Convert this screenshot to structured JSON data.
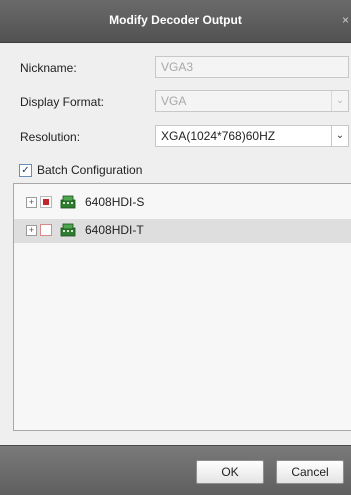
{
  "dialog": {
    "title": "Modify Decoder Output",
    "close_glyph": "×"
  },
  "form": {
    "nickname": {
      "label": "Nickname:",
      "value": "VGA3"
    },
    "display_format": {
      "label": "Display Format:",
      "value": "VGA"
    },
    "resolution": {
      "label": "Resolution:",
      "value": "XGA(1024*768)60HZ"
    },
    "dropdown_glyph": "⌄"
  },
  "batch": {
    "label": "Batch Configuration",
    "checked": true,
    "check_glyph": "✓"
  },
  "tree": {
    "expander_glyph": "+",
    "items": [
      {
        "name": "6408HDI-S",
        "state": "partial",
        "icon": "decoder-device-icon"
      },
      {
        "name": "6408HDI-T",
        "state": "unchecked",
        "icon": "decoder-device-icon"
      }
    ]
  },
  "buttons": {
    "ok": "OK",
    "cancel": "Cancel"
  },
  "colors": {
    "titlebar": "#5c5c5c",
    "footer": "#6c6c6c",
    "partial_check": "#c2252b",
    "device_icon": "#2e7d2e"
  }
}
